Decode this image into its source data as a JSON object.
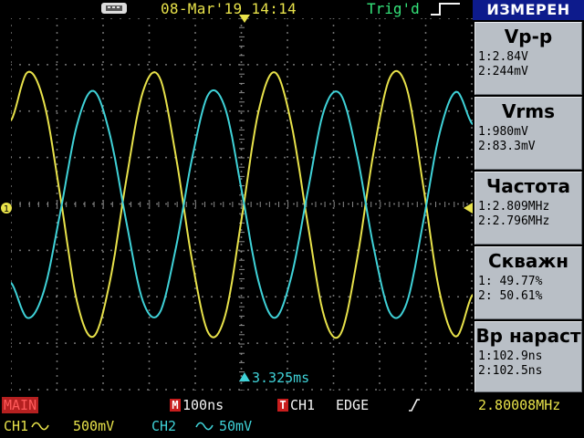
{
  "header": {
    "datetime": "08-Mar'19 14:14",
    "trigger_status": "Trig'd",
    "usb_icon": "usb-icon",
    "trigger_edge_icon": "rising-edge-icon"
  },
  "menu": {
    "title": "ИЗМЕРЕН",
    "measurements": [
      {
        "title": "Vp-p",
        "ch1": "1:2.84V",
        "ch2": "2:244mV"
      },
      {
        "title": "Vrms",
        "ch1": "1:980mV",
        "ch2": "2:83.3mV"
      },
      {
        "title": "Частота",
        "ch1": "1:2.809MHz",
        "ch2": "2:2.796MHz"
      },
      {
        "title": "Скважн",
        "ch1": "1: 49.77%",
        "ch2": "2: 50.61%"
      },
      {
        "title": "Вр нараст",
        "ch1": "1:102.9ns",
        "ch2": "2:102.5ns"
      }
    ]
  },
  "status": {
    "mode": "MAIN",
    "timebase_marker": "M",
    "timebase": "100ns",
    "trigger_marker": "T",
    "trigger_source": "CH1",
    "trigger_type": "EDGE",
    "trigger_frequency": "2.80008MHz",
    "ch1_label": "CH1",
    "ch1_scale": "500mV",
    "ch2_label": "CH2",
    "ch2_scale": "50mV",
    "horizontal_position": "3.325ms"
  },
  "colors": {
    "ch1": "#e8e24a",
    "ch2": "#3fd2d8",
    "grid": "#8a8a8a",
    "menu_title_bg": "#0d1b8c",
    "menu_box_bg": "#b9bfc6",
    "trigger_marker": "#c91d1d"
  },
  "chart_data": {
    "type": "line",
    "x_unit": "ns",
    "y_unit": "V",
    "xlim": [
      -700,
      700
    ],
    "series": [
      {
        "name": "CH1",
        "x": [
          -700,
          -650,
          -600,
          -550,
          -500,
          -450,
          -400,
          -350,
          -300,
          -250,
          -200,
          -150,
          -100,
          -50,
          0,
          50,
          100,
          150,
          200,
          250,
          300,
          350,
          400,
          450,
          500,
          550,
          600,
          650,
          700
        ],
        "y": [
          0.9,
          1.42,
          1.1,
          0.08,
          -1.04,
          -1.42,
          -0.83,
          0.27,
          1.21,
          1.37,
          0.52,
          -0.62,
          -1.39,
          -1.19,
          -0.14,
          0.99,
          1.42,
          0.87,
          -0.21,
          -1.21,
          -1.39,
          -0.58,
          0.57,
          1.37,
          1.25,
          0.2,
          -0.95,
          -1.42,
          -0.97
        ],
        "ylim": [
          -2.0,
          2.0
        ]
      },
      {
        "name": "CH2",
        "x": [
          -700,
          -650,
          -600,
          -550,
          -500,
          -450,
          -400,
          -350,
          -300,
          -250,
          -200,
          -150,
          -100,
          -50,
          0,
          50,
          100,
          150,
          200,
          250,
          300,
          350,
          400,
          450,
          500,
          550,
          600,
          650,
          700
        ],
        "y": [
          -0.084,
          -0.122,
          -0.093,
          -0.008,
          0.085,
          0.122,
          0.075,
          -0.019,
          -0.104,
          -0.117,
          -0.047,
          0.051,
          0.119,
          0.103,
          0.014,
          -0.082,
          -0.122,
          -0.078,
          0.014,
          0.102,
          0.118,
          0.052,
          -0.047,
          -0.117,
          -0.106,
          -0.019,
          0.077,
          0.121,
          0.086
        ],
        "ylim": [
          -0.2,
          0.2
        ]
      }
    ],
    "grid": true
  }
}
